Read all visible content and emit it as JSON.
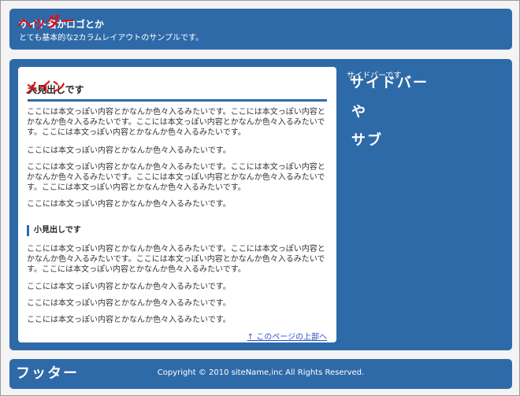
{
  "header": {
    "site_title": "サイト名かロゴとか",
    "site_description": "とても基本的な2カラムレイアウトのサンプルです。",
    "annotation": "ヘッダー"
  },
  "main": {
    "annotation": "メイン",
    "heading": "大見出しです",
    "paragraphs_top": [
      "ここには本文っぽい内容とかなんか色々入るみたいです。ここには本文っぽい内容とかなんか色々入るみたいです。ここには本文っぽい内容とかなんか色々入るみたいです。ここには本文っぽい内容とかなんか色々入るみたいです。",
      "ここには本文っぽい内容とかなんか色々入るみたいです。",
      "ここには本文っぽい内容とかなんか色々入るみたいです。ここには本文っぽい内容とかなんか色々入るみたいです。ここには本文っぽい内容とかなんか色々入るみたいです。ここには本文っぽい内容とかなんか色々入るみたいです。",
      "ここには本文っぽい内容とかなんか色々入るみたいです。"
    ],
    "sub_heading": "小見出しです",
    "paragraphs_bottom": [
      "ここには本文っぽい内容とかなんか色々入るみたいです。ここには本文っぽい内容とかなんか色々入るみたいです。ここには本文っぽい内容とかなんか色々入るみたいです。ここには本文っぽい内容とかなんか色々入るみたいです。",
      "ここには本文っぽい内容とかなんか色々入るみたいです。",
      "ここには本文っぽい内容とかなんか色々入るみたいです。",
      "ここには本文っぽい内容とかなんか色々入るみたいです。"
    ],
    "back_to_top": "↑ このページの上部へ"
  },
  "sidebar": {
    "text": "サイドバーです",
    "annotation_lines": [
      "サイドバー",
      "や",
      "サブ"
    ]
  },
  "footer": {
    "copyright": "Copyright © 2010 siteName,inc All Rights Reserved.",
    "annotation": "フッター"
  },
  "colors": {
    "panel_blue": "#2f6aa8",
    "annotation_red": "#e0101a",
    "link_blue": "#2a4fd0"
  }
}
